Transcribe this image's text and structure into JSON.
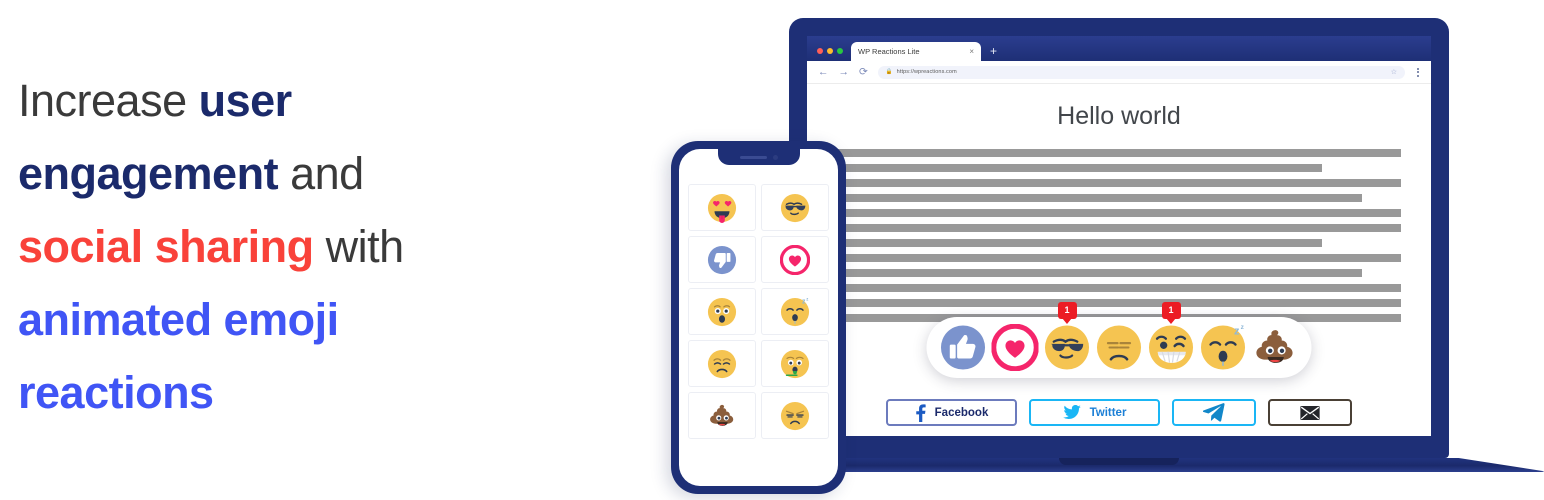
{
  "headline": {
    "line1_plain": "Increase ",
    "line1_bold_navy": "user",
    "line2_bold_navy": "engagement",
    "line2_plain": " and",
    "line3_bold_red": "social sharing",
    "line3_plain": " with",
    "line4_bold_blue": "animated emoji",
    "line5_bold_blue": "reactions"
  },
  "colors": {
    "navy": "#1b2a6b",
    "red": "#f9423a",
    "blue": "#4055f5",
    "device_frame": "#1e2f76",
    "badge_red": "#ec1c24",
    "heart_pink": "#f5256b",
    "thumb_blue": "#7b93cd",
    "twitter_blue": "#1ab6f5",
    "facebook_navy": "#1b2a6b",
    "skeleton_gray": "#999999"
  },
  "browser": {
    "window_dots": [
      "red",
      "yellow",
      "green"
    ],
    "tab": {
      "title": "WP Reactions Lite",
      "close_label": "×"
    },
    "new_tab_label": "+",
    "nav": {
      "back": "←",
      "forward": "→",
      "reload": "⟳"
    },
    "omnibox": {
      "lock_icon": "lock-icon",
      "url": "https://wpreactions.com"
    },
    "bookmark_icon": "star-icon",
    "menu_icon": "kebab-menu-icon"
  },
  "page": {
    "title": "Hello world",
    "skeleton_line_widths": [
      "100%",
      "86%",
      "100%",
      "93%",
      "100%",
      "100%",
      "86%",
      "100%",
      "93%",
      "100%",
      "100%",
      "100%"
    ]
  },
  "reactions": {
    "items": [
      {
        "name": "thumbs-up",
        "icon": "thumbs-up-icon",
        "count": null
      },
      {
        "name": "love",
        "icon": "heart-icon",
        "count": null
      },
      {
        "name": "cool",
        "icon": "sunglasses-face-icon",
        "count": "1"
      },
      {
        "name": "sad",
        "icon": "frowning-face-icon",
        "count": null
      },
      {
        "name": "funny",
        "icon": "winking-grin-face-icon",
        "count": "1"
      },
      {
        "name": "sleepy",
        "icon": "sleeping-face-icon",
        "count": null
      },
      {
        "name": "poop",
        "icon": "poop-icon",
        "count": null
      }
    ]
  },
  "share": {
    "buttons": [
      {
        "name": "facebook",
        "label": "Facebook",
        "icon": "facebook-icon"
      },
      {
        "name": "twitter",
        "label": "Twitter",
        "icon": "twitter-icon"
      },
      {
        "name": "telegram",
        "label": "",
        "icon": "telegram-icon"
      },
      {
        "name": "email",
        "label": "",
        "icon": "envelope-icon"
      }
    ]
  },
  "phone": {
    "emojis": [
      {
        "name": "heart-eyes-tongue",
        "icon": "heart-eyes-tongue-face-icon"
      },
      {
        "name": "cool",
        "icon": "sunglasses-face-icon"
      },
      {
        "name": "thumbs-down",
        "icon": "thumbs-down-icon"
      },
      {
        "name": "love",
        "icon": "heart-icon"
      },
      {
        "name": "astonished",
        "icon": "astonished-face-icon"
      },
      {
        "name": "sleeping",
        "icon": "sleeping-face-icon"
      },
      {
        "name": "disappointed",
        "icon": "disappointed-face-icon"
      },
      {
        "name": "sick",
        "icon": "nauseated-face-icon"
      },
      {
        "name": "poop",
        "icon": "poop-icon"
      },
      {
        "name": "tired",
        "icon": "tired-face-icon"
      }
    ]
  }
}
